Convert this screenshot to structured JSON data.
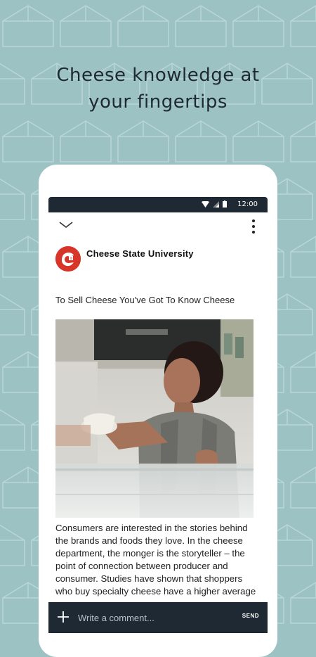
{
  "promo": {
    "headline_line1": "Cheese knowledge at",
    "headline_line2": "your fingertips"
  },
  "status_bar": {
    "time": "12:00",
    "icons": [
      "wifi-icon",
      "signal-icon",
      "battery-icon"
    ]
  },
  "app_bar": {
    "collapse_icon": "chevron-down-icon",
    "menu_icon": "more-vert-icon"
  },
  "article": {
    "source": "Cheese State University",
    "source_logo_icon": "university-logo-icon",
    "title": "To Sell Cheese You've Got To Know Cheese",
    "image_icon": "cheesemonger-photo",
    "body": "Consumers are interested in the stories behind the brands and foods they love. In the cheese department, the monger is the storyteller – the point of connection between producer and consumer. Studies have shown that shoppers who buy specialty cheese have a higher average"
  },
  "comment_bar": {
    "add_icon": "plus-icon",
    "placeholder": "Write a comment...",
    "send_label": "SEND"
  },
  "colors": {
    "background": "#9dc2c4",
    "pattern_stroke": "#b9d6d7",
    "dark_bar": "#1f2933",
    "logo_red": "#d8352a"
  }
}
